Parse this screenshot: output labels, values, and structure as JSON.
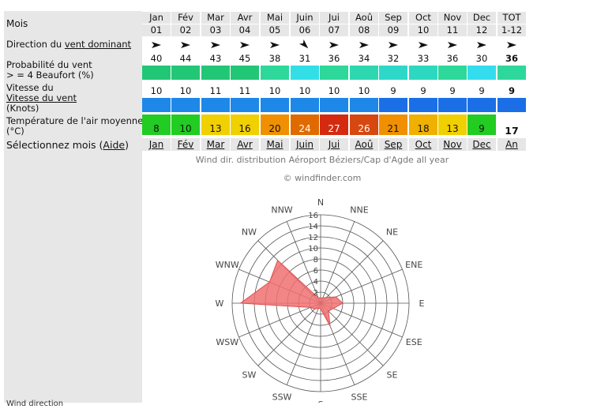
{
  "labels": {
    "mois": "Mois",
    "direction_prefix": "Direction du ",
    "direction_link": "vent dominant",
    "prob_line1": "Probabilité du vent",
    "prob_line2": "> = 4 Beaufort (%)",
    "speed_line1": "Vitesse du",
    "speed_link": "Vitesse du vent",
    "speed_line3": "(Knots)",
    "temp_line1": "Température de l'air moyenne",
    "temp_line2": "(°C)",
    "select_prefix": "Sélectionnez mois (",
    "select_link": "Aide",
    "select_suffix": ")",
    "bottom_cut": "Wind direction"
  },
  "months": [
    {
      "name": "Jan",
      "num": "01",
      "dir_deg": 90,
      "prob": "40",
      "prob_color": "#22c776",
      "speed": "10",
      "speed_color": "#1e88e8",
      "temp": "8",
      "temp_color": "#22cc22",
      "link": "Jan"
    },
    {
      "name": "Fév",
      "num": "02",
      "dir_deg": 90,
      "prob": "44",
      "prob_color": "#22c776",
      "speed": "10",
      "speed_color": "#1e88e8",
      "temp": "10",
      "temp_color": "#22cc22",
      "link": "Fév"
    },
    {
      "name": "Mar",
      "num": "03",
      "dir_deg": 90,
      "prob": "43",
      "prob_color": "#22c776",
      "speed": "11",
      "speed_color": "#1e88e8",
      "temp": "13",
      "temp_color": "#f0d000",
      "link": "Mar"
    },
    {
      "name": "Avr",
      "num": "04",
      "dir_deg": 90,
      "prob": "45",
      "prob_color": "#22c776",
      "speed": "11",
      "speed_color": "#1e88e8",
      "temp": "16",
      "temp_color": "#f0d000",
      "link": "Avr"
    },
    {
      "name": "Mai",
      "num": "05",
      "dir_deg": 90,
      "prob": "38",
      "prob_color": "#2dd89a",
      "speed": "10",
      "speed_color": "#1e88e8",
      "temp": "20",
      "temp_color": "#f09000",
      "link": "Mai"
    },
    {
      "name": "Juin",
      "num": "06",
      "dir_deg": 135,
      "prob": "31",
      "prob_color": "#33dfe6",
      "speed": "10",
      "speed_color": "#1e88e8",
      "temp": "24",
      "temp_color": "#e06a00",
      "link": "Juin"
    },
    {
      "name": "Jui",
      "num": "07",
      "dir_deg": 90,
      "prob": "36",
      "prob_color": "#2dd89a",
      "speed": "10",
      "speed_color": "#1e88e8",
      "temp": "27",
      "temp_color": "#d42a10",
      "link": "Jui"
    },
    {
      "name": "Aoû",
      "num": "08",
      "dir_deg": 90,
      "prob": "34",
      "prob_color": "#2dd8b0",
      "speed": "10",
      "speed_color": "#1e88e8",
      "temp": "26",
      "temp_color": "#d64810",
      "link": "Aoû"
    },
    {
      "name": "Sep",
      "num": "09",
      "dir_deg": 90,
      "prob": "32",
      "prob_color": "#2dd8c8",
      "speed": "9",
      "speed_color": "#1a6fe6",
      "temp": "21",
      "temp_color": "#f09000",
      "link": "Sep"
    },
    {
      "name": "Oct",
      "num": "10",
      "dir_deg": 90,
      "prob": "33",
      "prob_color": "#2dd8c0",
      "speed": "9",
      "speed_color": "#1a6fe6",
      "temp": "18",
      "temp_color": "#f0b000",
      "link": "Oct"
    },
    {
      "name": "Nov",
      "num": "11",
      "dir_deg": 90,
      "prob": "36",
      "prob_color": "#2dd89a",
      "speed": "9",
      "speed_color": "#1a6fe6",
      "temp": "13",
      "temp_color": "#f0d000",
      "link": "Nov"
    },
    {
      "name": "Dec",
      "num": "12",
      "dir_deg": 90,
      "prob": "30",
      "prob_color": "#33ddee",
      "speed": "9",
      "speed_color": "#1a6fe6",
      "temp": "9",
      "temp_color": "#22cc22",
      "link": "Dec"
    }
  ],
  "total": {
    "name": "TOT",
    "num": "1-12",
    "dir_deg": 90,
    "prob": "36",
    "prob_color": "#2dd89a",
    "speed": "9",
    "speed_color": "#1a6fe6",
    "temp": "17",
    "link": "An"
  },
  "chart_data": {
    "type": "radar",
    "title": "Wind dir. distribution Aéroport Béziers/Cap d'Agde all year",
    "credit": "© windfinder.com",
    "rlim": [
      0,
      16
    ],
    "r_ticks": [
      "0",
      "2",
      "4",
      "6",
      "8",
      "10",
      "12",
      "14",
      "16"
    ],
    "directions": [
      "N",
      "NNE",
      "NE",
      "ENE",
      "E",
      "ESE",
      "SE",
      "SSE",
      "S",
      "SSW",
      "SW",
      "WSW",
      "W",
      "WNW",
      "NW",
      "NNW"
    ],
    "values": [
      1,
      1,
      1.5,
      3,
      4,
      2.5,
      2,
      4.5,
      1,
      1,
      1.5,
      2,
      14.5,
      10,
      11,
      1
    ],
    "fill_color": "#f07070",
    "stroke_color": "#e05050"
  }
}
